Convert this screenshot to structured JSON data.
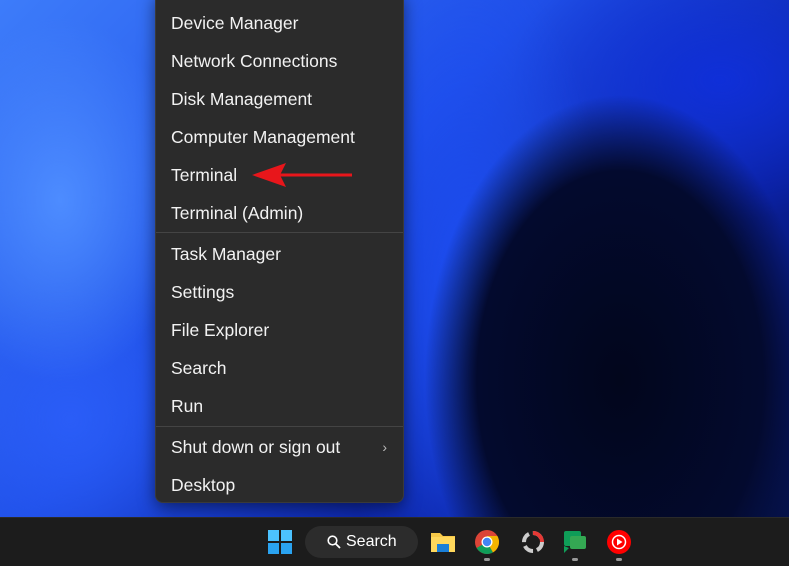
{
  "menu": {
    "group1": [
      "Device Manager",
      "Network Connections",
      "Disk Management",
      "Computer Management",
      "Terminal",
      "Terminal (Admin)"
    ],
    "group2": [
      "Task Manager",
      "Settings",
      "File Explorer",
      "Search",
      "Run"
    ],
    "group3": [
      "Shut down or sign out",
      "Desktop"
    ]
  },
  "annotation": {
    "arrow_color": "#e8161b",
    "target": "Terminal"
  },
  "taskbar": {
    "search_label": "Search",
    "apps": [
      "start-icon",
      "search",
      "file-explorer-icon",
      "chrome-icon",
      "capture-app-icon",
      "google-chat-icon",
      "youtube-music-icon"
    ]
  }
}
